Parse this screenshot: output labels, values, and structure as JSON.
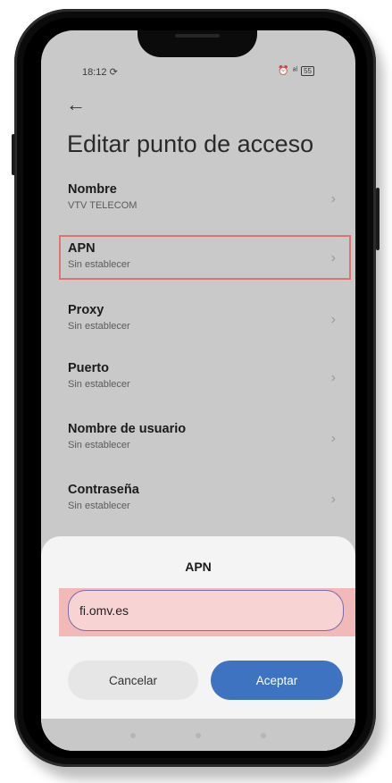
{
  "status_bar": {
    "time": "18:12",
    "sync_icon": "⟳",
    "alarm_icon": "⏰",
    "signal": "ᵃˡ",
    "battery": "55"
  },
  "header": {
    "back_icon": "←",
    "title": "Editar punto de acceso"
  },
  "settings": [
    {
      "label": "Nombre",
      "value": "VTV TELECOM"
    },
    {
      "label": "APN",
      "value": "Sin establecer"
    },
    {
      "label": "Proxy",
      "value": "Sin establecer"
    },
    {
      "label": "Puerto",
      "value": "Sin establecer"
    },
    {
      "label": "Nombre de usuario",
      "value": "Sin establecer"
    },
    {
      "label": "Contraseña",
      "value": "Sin establecer"
    }
  ],
  "chevron": "›",
  "dialog": {
    "title": "APN",
    "input_value": "fi.omv.es",
    "cancel_label": "Cancelar",
    "accept_label": "Aceptar"
  },
  "colors": {
    "accent": "#3d73c0",
    "highlight_border": "#e0726f",
    "highlight_fill": "#f1b9b8"
  }
}
